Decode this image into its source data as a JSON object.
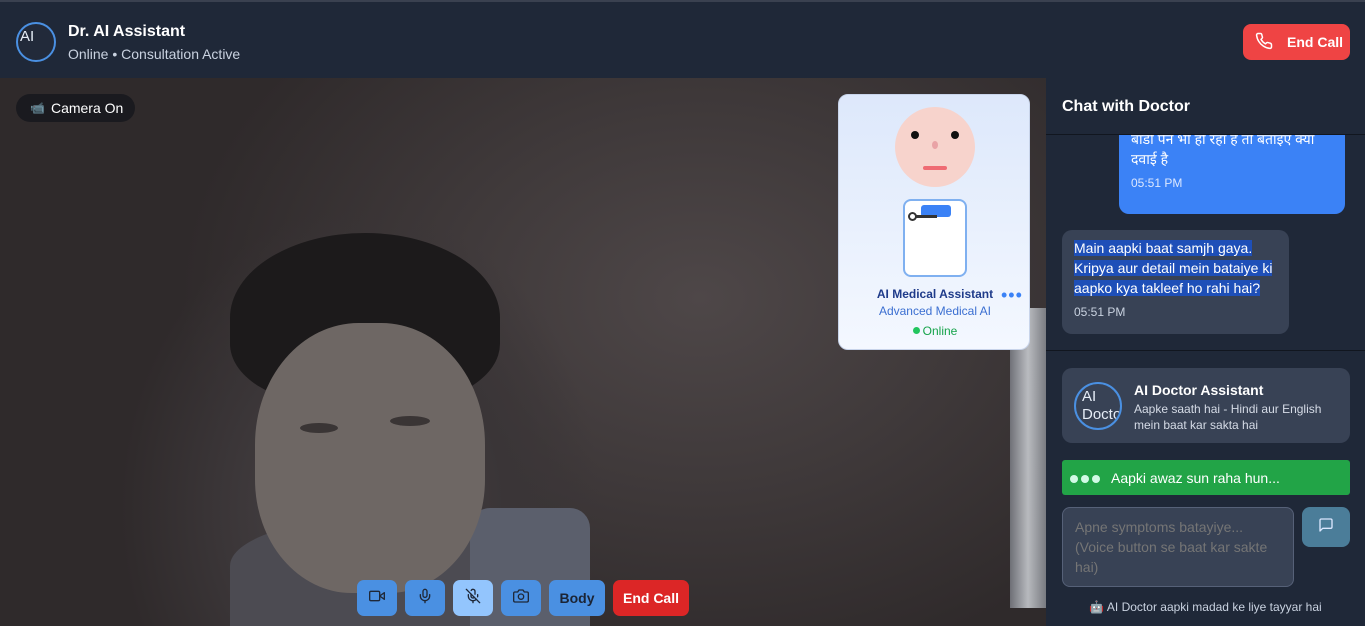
{
  "header": {
    "avatar_alt": "AI",
    "title": "Dr. AI Assistant",
    "subtitle": "Online • Consultation Active",
    "end_call_label": "End Call"
  },
  "video": {
    "camera_badge": "Camera On",
    "camera_icon": "📹"
  },
  "ai_card": {
    "name": "AI Medical Assistant",
    "role": "Advanced Medical AI",
    "status": "Online",
    "menu_glyph": "•••"
  },
  "controls": {
    "body_label": "Body",
    "end_call_label": "End Call"
  },
  "chat": {
    "title": "Chat with Doctor",
    "messages": [
      {
        "sender": "user",
        "text": "बॉडी पेन भी हो रहा है तो बताइए क्या दवाई है",
        "time": "05:51 PM"
      },
      {
        "sender": "ai",
        "text": "Main aapki baat samjh gaya. Kripya aur detail mein bataiye ki aapko kya takleef ho rahi hai?",
        "time": "05:51 PM"
      }
    ],
    "assistant": {
      "avatar_alt": "AI Doctor",
      "title": "AI Doctor Assistant",
      "subtitle": "Aapke saath hai - Hindi aur English mein baat kar sakta hai"
    },
    "listening_text": "Aapki awaz sun raha hun...",
    "input_placeholder": "Apne symptoms batayiye... (Voice button se baat kar sakte hai)",
    "footer_icon": "🤖",
    "footer_text": "AI Doctor aapki madad ke liye tayyar hai"
  },
  "colors": {
    "accent": "#4a90e2",
    "danger": "#ef4444",
    "success": "#22a447",
    "panel": "#1f2838"
  }
}
